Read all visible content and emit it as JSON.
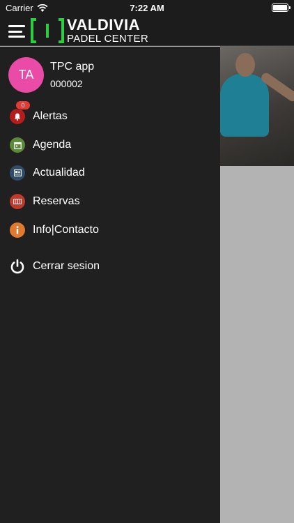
{
  "status_bar": {
    "carrier": "Carrier",
    "time": "7:22 AM",
    "battery_level": 0.9
  },
  "header": {
    "logo_line1": "VALDIVIA",
    "logo_line2": "PADEL CENTER"
  },
  "profile": {
    "initials": "TA",
    "name": "TPC app",
    "id": "000002"
  },
  "menu": {
    "alertas": {
      "label": "Alertas",
      "badge": "0",
      "icon": "bell-icon",
      "color": "#b71c1c"
    },
    "agenda": {
      "label": "Agenda",
      "icon": "calendar-icon",
      "color": "#5c8a3a"
    },
    "actualidad": {
      "label": "Actualidad",
      "icon": "newspaper-icon",
      "color": "#2f4d6b"
    },
    "reservas": {
      "label": "Reservas",
      "icon": "court-icon",
      "color": "#c0392b"
    },
    "info": {
      "label": "Info|Contacto",
      "icon": "info-icon",
      "color": "#e07a2e"
    },
    "logout": {
      "label": "Cerrar sesion",
      "icon": "power-icon"
    }
  },
  "colors": {
    "accent_green": "#2ecc40",
    "avatar": "#e94ba7",
    "drawer_bg": "#202020"
  }
}
